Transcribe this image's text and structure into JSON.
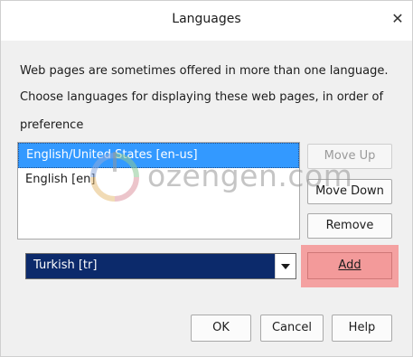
{
  "dialog": {
    "title": "Languages",
    "close_glyph": "✕",
    "description_line1": "Web pages are sometimes offered in more than one language.",
    "description_line2": "Choose languages for displaying these web pages, in order of",
    "description_line3": "preference"
  },
  "languages": {
    "items": [
      {
        "label": "English/United States  [en-us]",
        "selected": true
      },
      {
        "label": "English  [en]",
        "selected": false
      }
    ]
  },
  "buttons": {
    "move_up": "Move Up",
    "move_down": "Move Down",
    "remove": "Remove",
    "add": "Add",
    "ok": "OK",
    "cancel": "Cancel",
    "help": "Help"
  },
  "select": {
    "value": "Turkish  [tr]"
  },
  "watermark": {
    "text": "ozengen.com"
  },
  "colors": {
    "selection": "#3399ff",
    "select_bg": "#0c2a6b",
    "highlight": "#f4a1a1"
  },
  "icons": {
    "close": "close-icon",
    "dropdown": "chevron-down-icon"
  }
}
